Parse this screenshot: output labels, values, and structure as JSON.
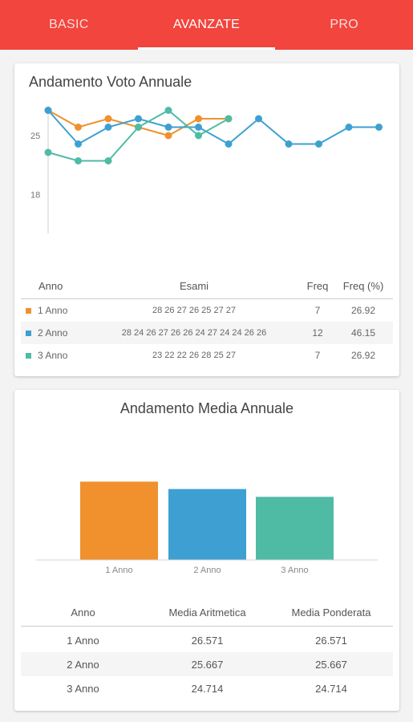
{
  "tabs": [
    {
      "label": "BASIC",
      "active": false
    },
    {
      "label": "AVANZATE",
      "active": true
    },
    {
      "label": "PRO",
      "active": false
    }
  ],
  "colors": {
    "accent": "#f1453d",
    "series_1": "#f0912e",
    "series_2": "#3ea0d2",
    "series_3": "#4fbba5"
  },
  "card1": {
    "title": "Andamento Voto Annuale",
    "table": {
      "headers": {
        "anno": "Anno",
        "esami": "Esami",
        "freq": "Freq",
        "perc": "Freq (%)"
      },
      "rows": [
        {
          "anno": "1 Anno",
          "esami": "28 26 27 26 25 27 27",
          "freq": "7",
          "perc": "26.92"
        },
        {
          "anno": "2 Anno",
          "esami": "28 24 26 27 26 26 24 27 24 24 26 26",
          "freq": "12",
          "perc": "46.15"
        },
        {
          "anno": "3 Anno",
          "esami": "23 22 22 26 28 25 27",
          "freq": "7",
          "perc": "26.92"
        }
      ]
    }
  },
  "card2": {
    "title": "Andamento Media Annuale",
    "table": {
      "headers": {
        "anno": "Anno",
        "aritmetica": "Media Aritmetica",
        "ponderata": "Media Ponderata"
      },
      "rows": [
        {
          "anno": "1 Anno",
          "aritmetica": "26.571",
          "ponderata": "26.571"
        },
        {
          "anno": "2 Anno",
          "aritmetica": "25.667",
          "ponderata": "25.667"
        },
        {
          "anno": "3 Anno",
          "aritmetica": "24.714",
          "ponderata": "24.714"
        }
      ]
    }
  },
  "chart_data": [
    {
      "type": "line",
      "x": [
        1,
        2,
        3,
        4,
        5,
        6,
        7,
        8,
        9,
        10,
        11,
        12
      ],
      "ylim": [
        18,
        30
      ],
      "yticks": [
        "30",
        "25",
        "18"
      ],
      "series": [
        {
          "name": "1 Anno",
          "values": [
            28,
            26,
            27,
            26,
            25,
            27,
            27
          ]
        },
        {
          "name": "2 Anno",
          "values": [
            28,
            24,
            26,
            27,
            26,
            26,
            24,
            27,
            24,
            24,
            26,
            26
          ]
        },
        {
          "name": "3 Anno",
          "values": [
            23,
            22,
            22,
            26,
            28,
            25,
            27
          ]
        }
      ]
    },
    {
      "type": "bar",
      "categories": [
        "1 Anno",
        "2 Anno",
        "3 Anno"
      ],
      "values": [
        26.571,
        25.667,
        24.714
      ],
      "ylim": [
        17,
        27
      ]
    }
  ]
}
